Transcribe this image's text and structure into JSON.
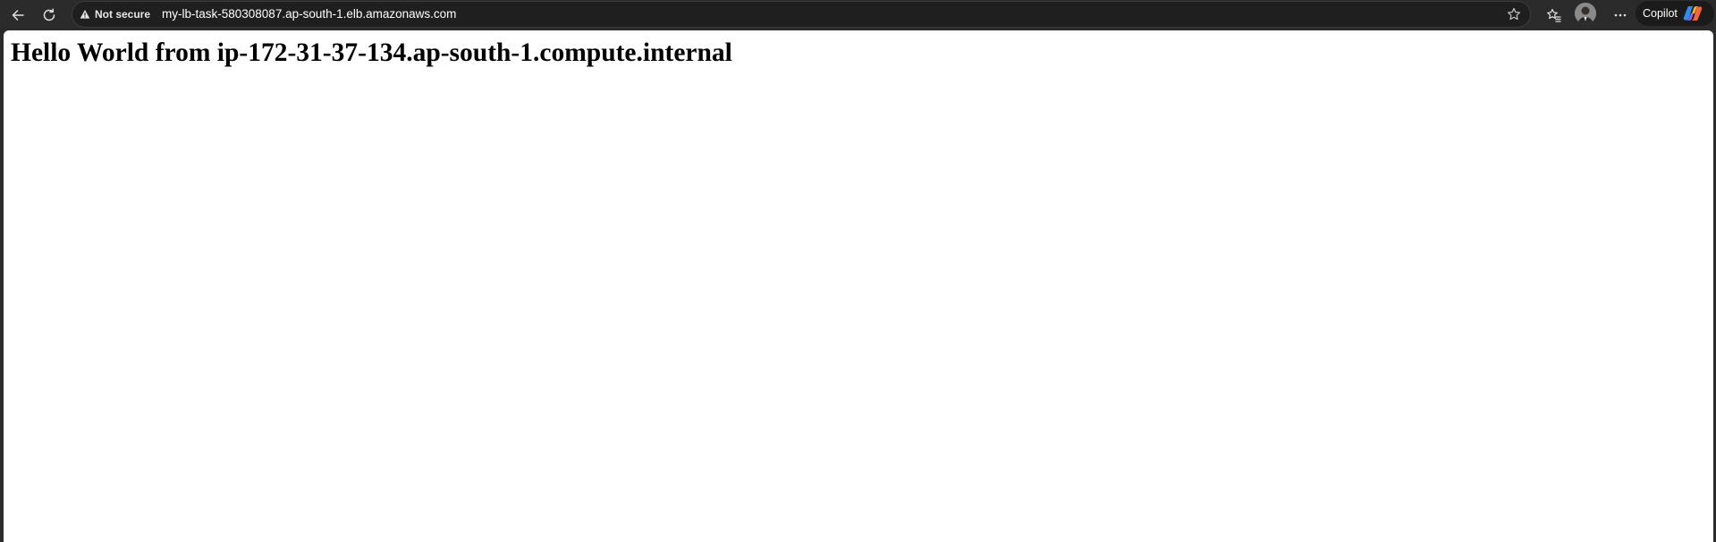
{
  "toolbar": {
    "security_label": "Not secure",
    "url": "my-lb-task-580308087.ap-south-1.elb.amazonaws.com",
    "copilot_label": "Copilot",
    "icons": {
      "back": "back-arrow-icon",
      "refresh": "refresh-icon",
      "warning": "warning-triangle-icon",
      "favorite": "star-icon",
      "favorites": "favorites-icon",
      "profile": "avatar",
      "more": "more-icon",
      "copilot": "copilot-icon"
    }
  },
  "page": {
    "heading": "Hello World from ip-172-31-37-134.ap-south-1.compute.internal"
  }
}
